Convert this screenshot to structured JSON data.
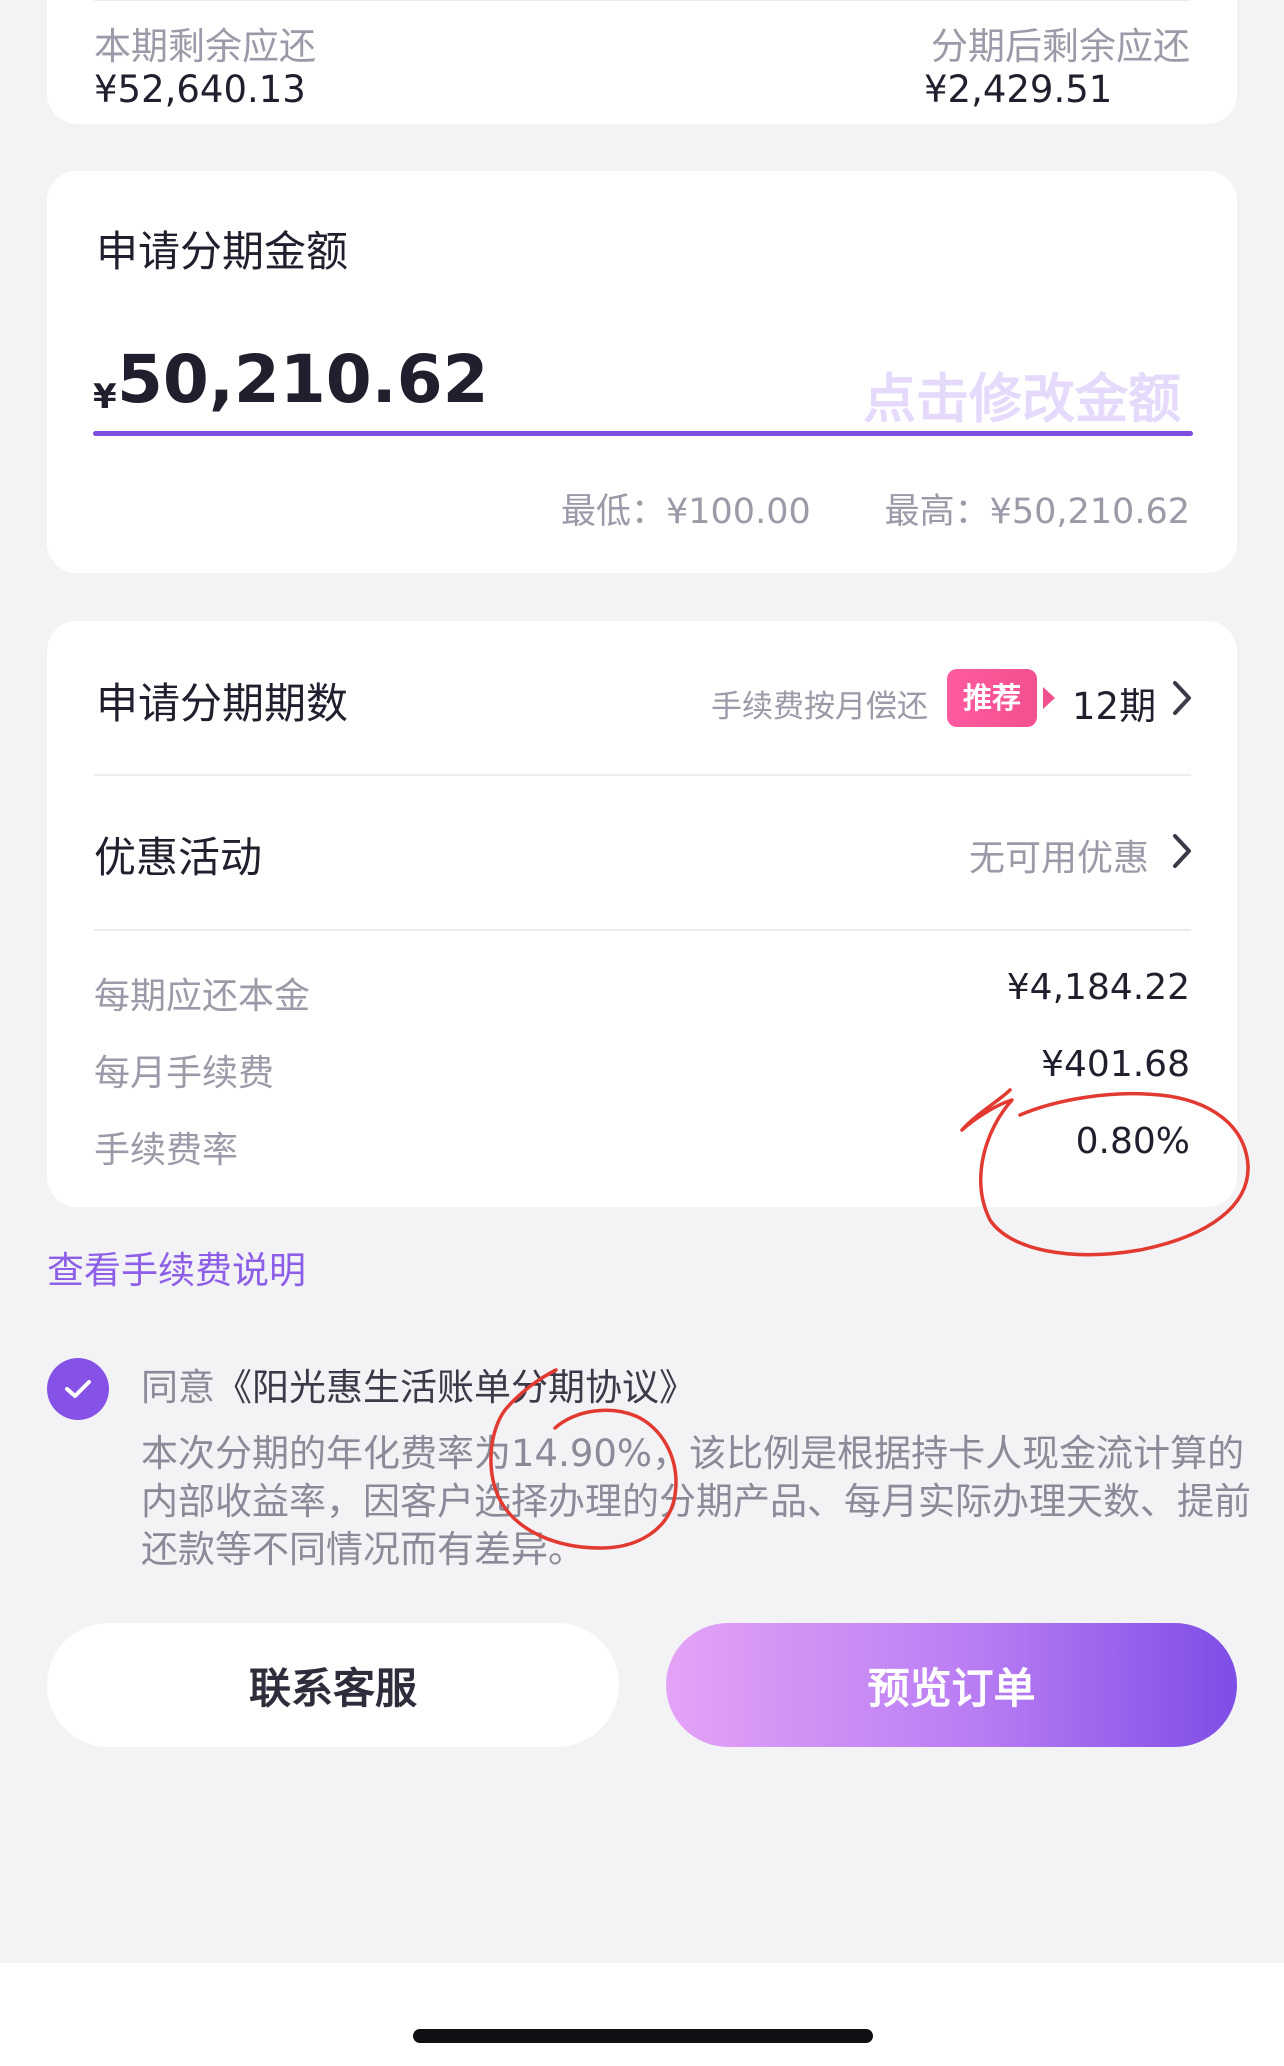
{
  "summary": {
    "current_remaining_label": "本期剩余应还",
    "current_remaining_value": "¥52,640.13",
    "after_installment_label": "分期后剩余应还",
    "after_installment_value": "¥2,429.51"
  },
  "amount_card": {
    "title": "申请分期金额",
    "currency_symbol": "¥",
    "amount": "50,210.62",
    "edit_hint": "点击修改金额",
    "min_label": "最低：¥100.00",
    "max_label": "最高：¥50,210.62"
  },
  "installment_card": {
    "periods_label": "申请分期期数",
    "fee_note": "手续费按月偿还",
    "recommend_badge": "推荐",
    "periods_value": "12期",
    "promo_label": "优惠活动",
    "promo_value": "无可用优惠",
    "details": [
      {
        "label": "每期应还本金",
        "value": "¥4,184.22"
      },
      {
        "label": "每月手续费",
        "value": "¥401.68"
      },
      {
        "label": "手续费率",
        "value": "0.80%"
      }
    ]
  },
  "fee_link": "查看手续费说明",
  "agreement": {
    "checked": true,
    "prefix": "同意",
    "name": "《阳光惠生活账单分期协议》",
    "notice": "本次分期的年化费率为14.90%，该比例是根据持卡人现金流计算的内部收益率，因客户选择办理的分期产品、每月实际办理天数、提前还款等不同情况而有差异。"
  },
  "buttons": {
    "contact": "联系客服",
    "preview": "预览订单"
  },
  "colors": {
    "accent": "#7c4ddf",
    "badge": "#ff5aa0",
    "annotation": "#e23a30"
  }
}
